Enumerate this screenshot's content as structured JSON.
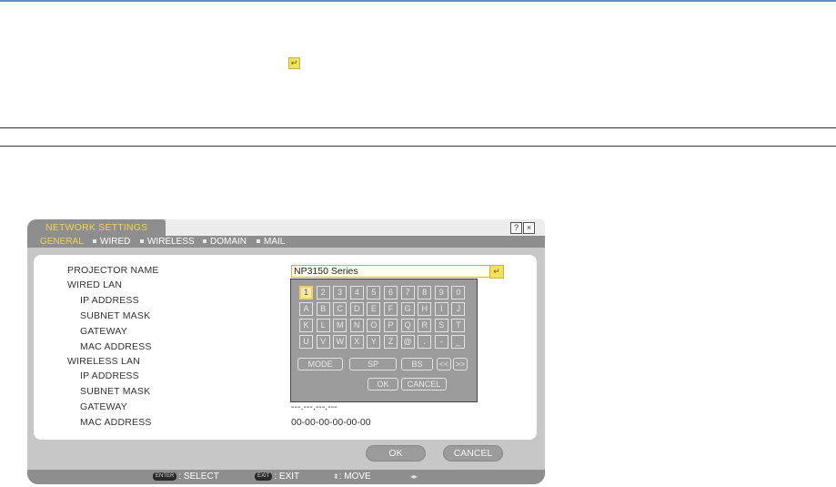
{
  "osd": {
    "title": "NETWORK SETTINGS",
    "help_icon": "?",
    "close_icon": "×",
    "tabs": [
      {
        "label": "GENERAL",
        "active": true
      },
      {
        "label": "WIRED",
        "active": false
      },
      {
        "label": "WIRELESS",
        "active": false
      },
      {
        "label": "DOMAIN",
        "active": false
      },
      {
        "label": "MAIL",
        "active": false
      }
    ],
    "labels": {
      "projector_name": "PROJECTOR NAME",
      "wired_lan": "WIRED LAN",
      "wired_ip": "IP ADDRESS",
      "wired_subnet": "SUBNET MASK",
      "wired_gateway": "GATEWAY",
      "wired_mac": "MAC ADDRESS",
      "wireless_lan": "WIRELESS LAN",
      "wireless_ip": "IP ADDRESS",
      "wireless_subnet": "SUBNET MASK",
      "wireless_gateway": "GATEWAY",
      "wireless_mac": "MAC ADDRESS"
    },
    "projector_name_value": "NP3150 Series",
    "wireless_gateway_value": "---.---.---.---",
    "wireless_mac_value": "00-00-00-00-00-00",
    "ok_label": "OK",
    "cancel_label": "CANCEL",
    "enter_glyph": "↵"
  },
  "keyboard": {
    "rows": [
      [
        "1",
        "2",
        "3",
        "4",
        "5",
        "6",
        "7",
        "8",
        "9",
        "0"
      ],
      [
        "A",
        "B",
        "C",
        "D",
        "E",
        "F",
        "G",
        "H",
        "I",
        "J"
      ],
      [
        "K",
        "L",
        "M",
        "N",
        "O",
        "P",
        "Q",
        "R",
        "S",
        "T"
      ],
      [
        "U",
        "V",
        "W",
        "X",
        "Y",
        "Z",
        "@",
        ".",
        "-",
        "_"
      ]
    ],
    "selected": "1",
    "mode_label": "MODE",
    "sp_label": "SP",
    "bs_label": "BS",
    "left_label": "<<",
    "right_label": ">>",
    "ok_label": "OK",
    "cancel_label": "CANCEL"
  },
  "helpbar": {
    "enter_key": "ENTER",
    "select_label": ": SELECT",
    "exit_key": "EXIT",
    "exit_label": ": EXIT",
    "move_symbol": "⬍",
    "move_label": ": MOVE",
    "lr_symbol": "◂▸"
  }
}
